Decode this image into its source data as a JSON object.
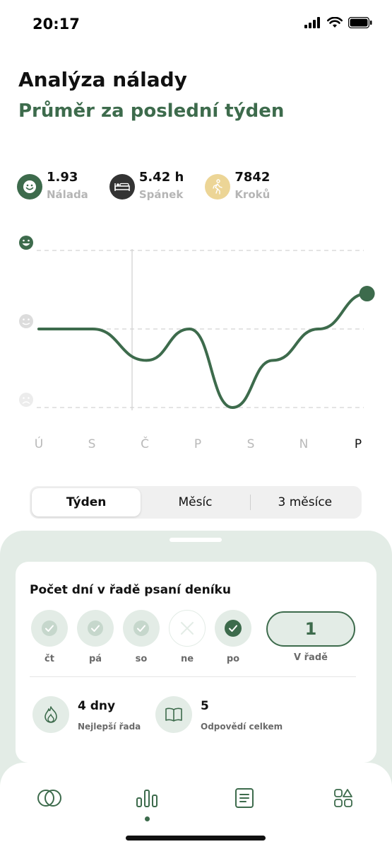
{
  "status": {
    "time": "20:17"
  },
  "header": {
    "title": "Analýza nálady",
    "subtitle": "Průměr za poslední týden"
  },
  "stats": [
    {
      "icon": "smile-icon",
      "value": "1.93",
      "label": "Nálada",
      "color": "#3d6b4c"
    },
    {
      "icon": "bed-icon",
      "value": "5.42 h",
      "label": "Spánek",
      "color": "#333333"
    },
    {
      "icon": "walk-icon",
      "value": "7842",
      "label": "Kroků",
      "color": "#ecd596"
    }
  ],
  "chart_data": {
    "type": "line",
    "categories": [
      "Ú",
      "S",
      "Č",
      "P",
      "S",
      "N",
      "P"
    ],
    "selected_category": "P",
    "y_scale": [
      "sad",
      "neutral",
      "happy"
    ],
    "series": [
      {
        "values": [
          2.0,
          2.0,
          1.6,
          2.0,
          1.0,
          1.6,
          2.0,
          2.45
        ],
        "x": [
          0,
          1,
          2,
          2.8,
          3.6,
          4.35,
          5.2,
          6.1
        ]
      }
    ],
    "ylim": [
      1,
      3
    ],
    "line_color": "#3d6b4c"
  },
  "periods": {
    "week": "Týden",
    "month": "Měsíc",
    "three_months": "3 měsíce",
    "active": "week"
  },
  "journal": {
    "title": "Počet dní v řadě psaní deníku",
    "days": [
      {
        "label": "čt",
        "state": "done"
      },
      {
        "label": "pá",
        "state": "done"
      },
      {
        "label": "so",
        "state": "done"
      },
      {
        "label": "ne",
        "state": "missed"
      },
      {
        "label": "po",
        "state": "today"
      }
    ],
    "streak_value": "1",
    "streak_label": "V řadě",
    "best_value": "4 dny",
    "best_label": "Nejlepší řada",
    "answers_value": "5",
    "answers_label": "Odpovědí celkem"
  },
  "tabs": [
    {
      "icon": "overlap-circles-icon"
    },
    {
      "icon": "bar-chart-icon",
      "active": true
    },
    {
      "icon": "journal-icon"
    },
    {
      "icon": "grid-shapes-icon"
    }
  ]
}
